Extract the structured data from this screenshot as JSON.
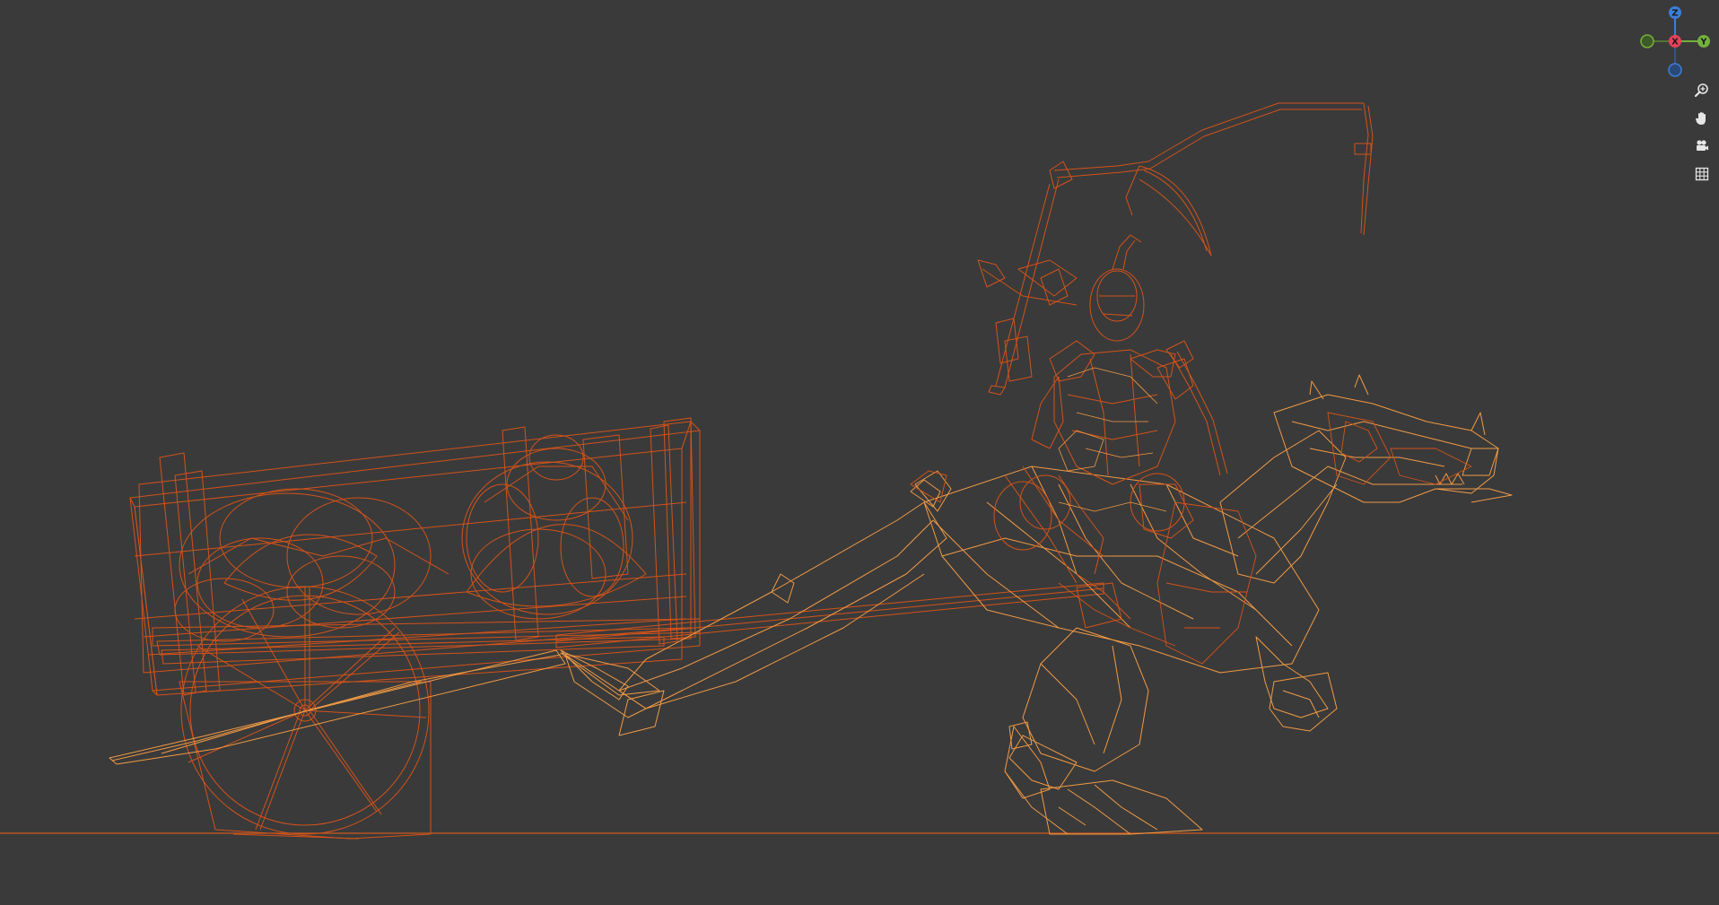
{
  "viewport": {
    "background": "#3a3a3a",
    "wire_color_dark": "#d2531a",
    "wire_color_light": "#f09a45",
    "ground_color": "#c9591f"
  },
  "gizmo": {
    "z_label": "Z",
    "x_label": "X",
    "y_label": "Y",
    "z_color": "#3b7ed8",
    "x_color": "#e8415a",
    "y_color": "#74b23b"
  },
  "nav_tools": [
    {
      "icon": "zoom-icon"
    },
    {
      "icon": "hand-pan-icon"
    },
    {
      "icon": "camera-icon"
    },
    {
      "icon": "grid-icon"
    }
  ]
}
